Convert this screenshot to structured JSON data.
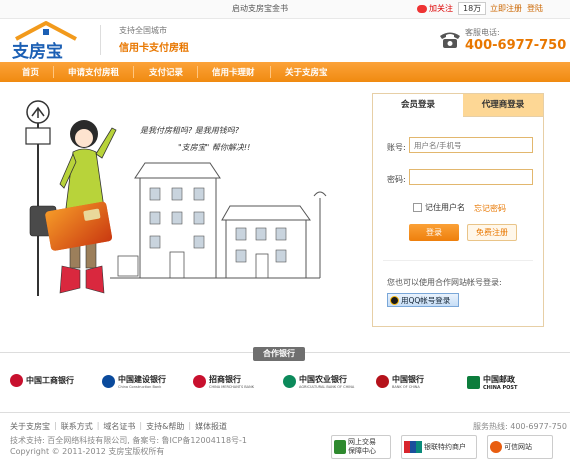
{
  "topbar": {
    "center_text": "启动支房宝金书",
    "weibo_label": "加关注",
    "weibo_count": "18万",
    "register": "立即注册",
    "login": "登陆"
  },
  "header": {
    "logo_text": "支房宝",
    "slogan_small": "支持全国城市",
    "slogan_main": "信用卡支付房租",
    "hotline_label": "客服电话:",
    "hotline_number": "400-6977-750"
  },
  "nav": {
    "items": [
      "首页",
      "申请支付房租",
      "支付记录",
      "信用卡理财",
      "关于支房宝"
    ]
  },
  "illustration": {
    "bubble_line1": "是我付房租吗? 是我用钱吗?",
    "bubble_line2": "\"支房宝\" 帮你解决!!"
  },
  "login": {
    "tab_member": "会员登录",
    "tab_agent": "代理商登录",
    "account_label": "账号:",
    "account_placeholder": "用户名/手机号",
    "password_label": "密码:",
    "password_value": "",
    "remember_label": "记住用户名",
    "forgot_label": "忘记密码",
    "login_button": "登录",
    "register_button": "免费注册",
    "oauth_text": "您也可以使用合作网站帐号登录:",
    "qq_button": "用QQ帐号登录"
  },
  "partners": {
    "title": "合作银行",
    "banks": [
      {
        "cn": "中国工商银行",
        "en": "",
        "color": "#c8102e"
      },
      {
        "cn": "中国建设银行",
        "en": "China Construction Bank",
        "color": "#0a4a9c"
      },
      {
        "cn": "招商银行",
        "en": "CHINA MERCHANTS BANK",
        "color": "#c8102e"
      },
      {
        "cn": "中国农业银行",
        "en": "AGRICULTURAL BANK OF CHINA",
        "color": "#0c8a5b"
      },
      {
        "cn": "中国银行",
        "en": "BANK OF CHINA",
        "color": "#b5121b"
      },
      {
        "cn": "中国邮政",
        "en": "CHINA POST",
        "color": "#0c7d3c"
      }
    ]
  },
  "footer": {
    "links": [
      "关于支房宝",
      "联系方式",
      "域名证书",
      "支持&帮助",
      "媒体报道"
    ],
    "hotline": "服务热线: 400-6977-750",
    "tech": "技术支持: 百全网络科技有限公司, 备案号: 鲁ICP备12004118号-1",
    "copyright": "Copyright © 2011-2012 支房宝版权所有",
    "badges": [
      {
        "line1": "网上交易",
        "line2": "保障中心"
      },
      {
        "line1": "银联特约商户",
        "line2": ""
      },
      {
        "line1": "可信网站",
        "line2": ""
      }
    ]
  },
  "colors": {
    "accent": "#f08a10",
    "nav_top": "#fca33a",
    "tab_inactive": "#fdd795"
  }
}
